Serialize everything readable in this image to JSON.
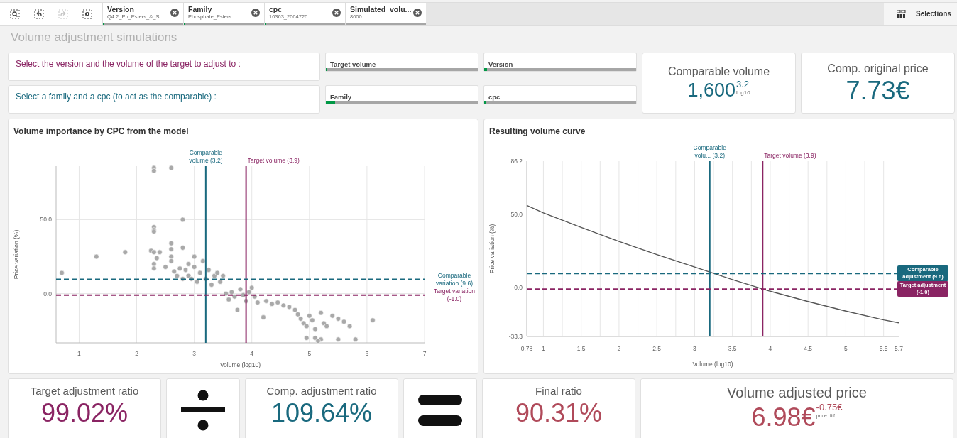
{
  "toolbar": {
    "tools": [
      {
        "kind": "smart-search",
        "disabled": false
      },
      {
        "kind": "step-back",
        "disabled": false
      },
      {
        "kind": "step-forward",
        "disabled": true
      },
      {
        "kind": "clear",
        "disabled": false
      }
    ],
    "chips": [
      {
        "title": "Version",
        "value": "Q4.2_Ph_Esters_&_S...",
        "level": 0.02
      },
      {
        "title": "Family",
        "value": "Phosphate_Esters",
        "level": 0.02
      },
      {
        "title": "cpc",
        "value": "10363_2064726",
        "level": 0.01
      },
      {
        "title": "Simulated_volu...",
        "value": "8000",
        "level": 0.01
      }
    ],
    "selections_label": "Selections"
  },
  "page_title": "Volume adjustment simulations",
  "prompts": [
    {
      "text": "Select the version and the volume of the target to adjust to :",
      "color": "#8a2463"
    },
    {
      "text": "Select a family and a cpc (to act as the comparable) :",
      "color": "#19697e"
    }
  ],
  "filters": [
    {
      "label": "Target volume",
      "level": 0.01
    },
    {
      "label": "Version",
      "level": 0.02
    },
    {
      "label": "Family",
      "level": 0.06
    },
    {
      "label": "cpc",
      "level": 0.01
    }
  ],
  "top_kpis": [
    {
      "title": "Comparable volume",
      "value": "1,600",
      "sup": "3.2",
      "sub": "log10",
      "color": "#19697e"
    },
    {
      "title": "Comp. original price",
      "value": "7.73€",
      "color": "#19697e"
    }
  ],
  "charts": [
    {
      "title": "Volume importance by CPC from the model",
      "chart_data": {
        "type": "scatter",
        "xlabel": "Volume (log10)",
        "ylabel": "Price variation (%)",
        "grid": true,
        "xlim": [
          0.6,
          7
        ],
        "ylim": [
          -33.3,
          86.2
        ],
        "xticks": [
          1,
          2,
          3,
          4,
          5,
          6,
          7
        ],
        "yticks": [
          {
            "value": 0,
            "label": "0.0"
          },
          {
            "value": 50,
            "label": "50.0"
          }
        ],
        "x": [
          0.7,
          1.3,
          1.8,
          2.3,
          2.3,
          2.6,
          2.3,
          2.3,
          2.3,
          2.8,
          2.25,
          2.3,
          2.35,
          2.3,
          2.3,
          2.4,
          2.5,
          2.6,
          2.6,
          2.6,
          2.6,
          2.65,
          2.7,
          2.75,
          2.8,
          2.8,
          2.85,
          2.9,
          2.9,
          2.95,
          3.0,
          3.0,
          3.05,
          3.1,
          3.15,
          3.2,
          3.25,
          3.3,
          3.35,
          3.4,
          3.45,
          3.5,
          3.55,
          3.6,
          3.65,
          3.7,
          3.75,
          3.8,
          3.85,
          3.9,
          3.95,
          4.0,
          4.05,
          4.1,
          4.2,
          4.25,
          4.35,
          4.45,
          4.55,
          4.65,
          4.75,
          4.8,
          4.85,
          4.9,
          4.95,
          5.0,
          5.05,
          5.1,
          5.2,
          5.25,
          5.3,
          5.4,
          5.5,
          5.6,
          5.7,
          6.1,
          4.95,
          5.1,
          5.2,
          5.5,
          5.8,
          5.15
        ],
        "series": [
          {
            "color": "#a9a9a9",
            "values": [
              14,
              25,
              28,
              85,
              83,
              85,
              45,
              43,
              42,
              50,
              29,
              28,
              24,
              20,
              17,
              28,
              18,
              34,
              30,
              25,
              22,
              15,
              12,
              17,
              31,
              10,
              16,
              20,
              12,
              10,
              18,
              25,
              8,
              14,
              22,
              10,
              16,
              6,
              12,
              14,
              8,
              12,
              0,
              -4,
              1,
              -2,
              -11,
              3,
              -1,
              -5,
              1,
              4,
              -2,
              -6,
              -16,
              -5,
              -7,
              -6,
              -8,
              -9,
              -11,
              -14,
              -17,
              -20,
              -22,
              -15,
              -18,
              -24,
              -13,
              -20,
              -22,
              -15,
              -17,
              -19,
              -22,
              -18,
              -30,
              -30,
              -31,
              -31,
              -31,
              -32
            ]
          }
        ],
        "ref_lines": [
          {
            "axis": "x",
            "value": 3.2,
            "label": "Comparable volume (3.2)",
            "color": "#19697e"
          },
          {
            "axis": "x",
            "value": 3.9,
            "label": "Target volume (3.9)",
            "color": "#8a2463"
          },
          {
            "axis": "y",
            "value": 9.6,
            "label": "Comparable variation (9.6)",
            "color": "#19697e"
          },
          {
            "axis": "y",
            "value": -1.0,
            "label": "Target variation (-1.0)",
            "color": "#8a2463"
          }
        ]
      }
    },
    {
      "title": "Resulting volume curve",
      "chart_data": {
        "type": "line",
        "xlabel": "Volume (log10)",
        "ylabel": "Price variation (%)",
        "grid": true,
        "xlim": [
          0.78,
          5.7
        ],
        "ylim": [
          -33.3,
          86.2
        ],
        "xticks": [
          {
            "value": 0.78,
            "label": "0.78"
          },
          1,
          1.5,
          2,
          2.5,
          3,
          3.5,
          4,
          4.5,
          5,
          5.5,
          5.7
        ],
        "yticks": [
          {
            "value": -33.3,
            "label": "-33.3"
          },
          {
            "value": 0,
            "label": "0.0"
          },
          {
            "value": 50,
            "label": "50.0"
          },
          {
            "value": 86.2,
            "label": "86.2"
          }
        ],
        "x": [
          0.78,
          1,
          1.5,
          2,
          2.5,
          3,
          3.5,
          4,
          4.5,
          5,
          5.5,
          5.7
        ],
        "series": [
          {
            "color": "#555555",
            "values": [
              56,
              51,
              41,
              31.5,
              22.5,
              14,
              5.5,
              -2.5,
              -9.5,
              -16,
              -22,
              -24
            ]
          }
        ],
        "ref_lines": [
          {
            "axis": "x",
            "value": 3.2,
            "label": "Comparable volu... (3.2)",
            "color": "#19697e"
          },
          {
            "axis": "x",
            "value": 3.9,
            "label": "Target volume (3.9)",
            "color": "#8a2463"
          },
          {
            "axis": "y",
            "value": 9.6,
            "label": "Comparable adjustment (9.6)",
            "color": "#19697e"
          },
          {
            "axis": "y",
            "value": -1.0,
            "label": "Target adjustment (-1.0)",
            "color": "#8a2463"
          }
        ]
      }
    }
  ],
  "bottom": [
    {
      "kind": "kpi",
      "title": "Target adjustment ratio",
      "value": "99.02%",
      "color": "#8a2463"
    },
    {
      "kind": "divide"
    },
    {
      "kind": "kpi",
      "title": "Comp. adjustment ratio",
      "value": "109.64%",
      "color": "#19697e"
    },
    {
      "kind": "equals"
    },
    {
      "kind": "kpi",
      "title": "Final ratio",
      "value": "90.31%",
      "color": "#b04a5a"
    },
    {
      "kind": "kpi",
      "title": "Volume adjusted price",
      "value": "6.98€",
      "sup": "-0.75€",
      "sub": "price diff",
      "color": "#b04a5a"
    }
  ]
}
